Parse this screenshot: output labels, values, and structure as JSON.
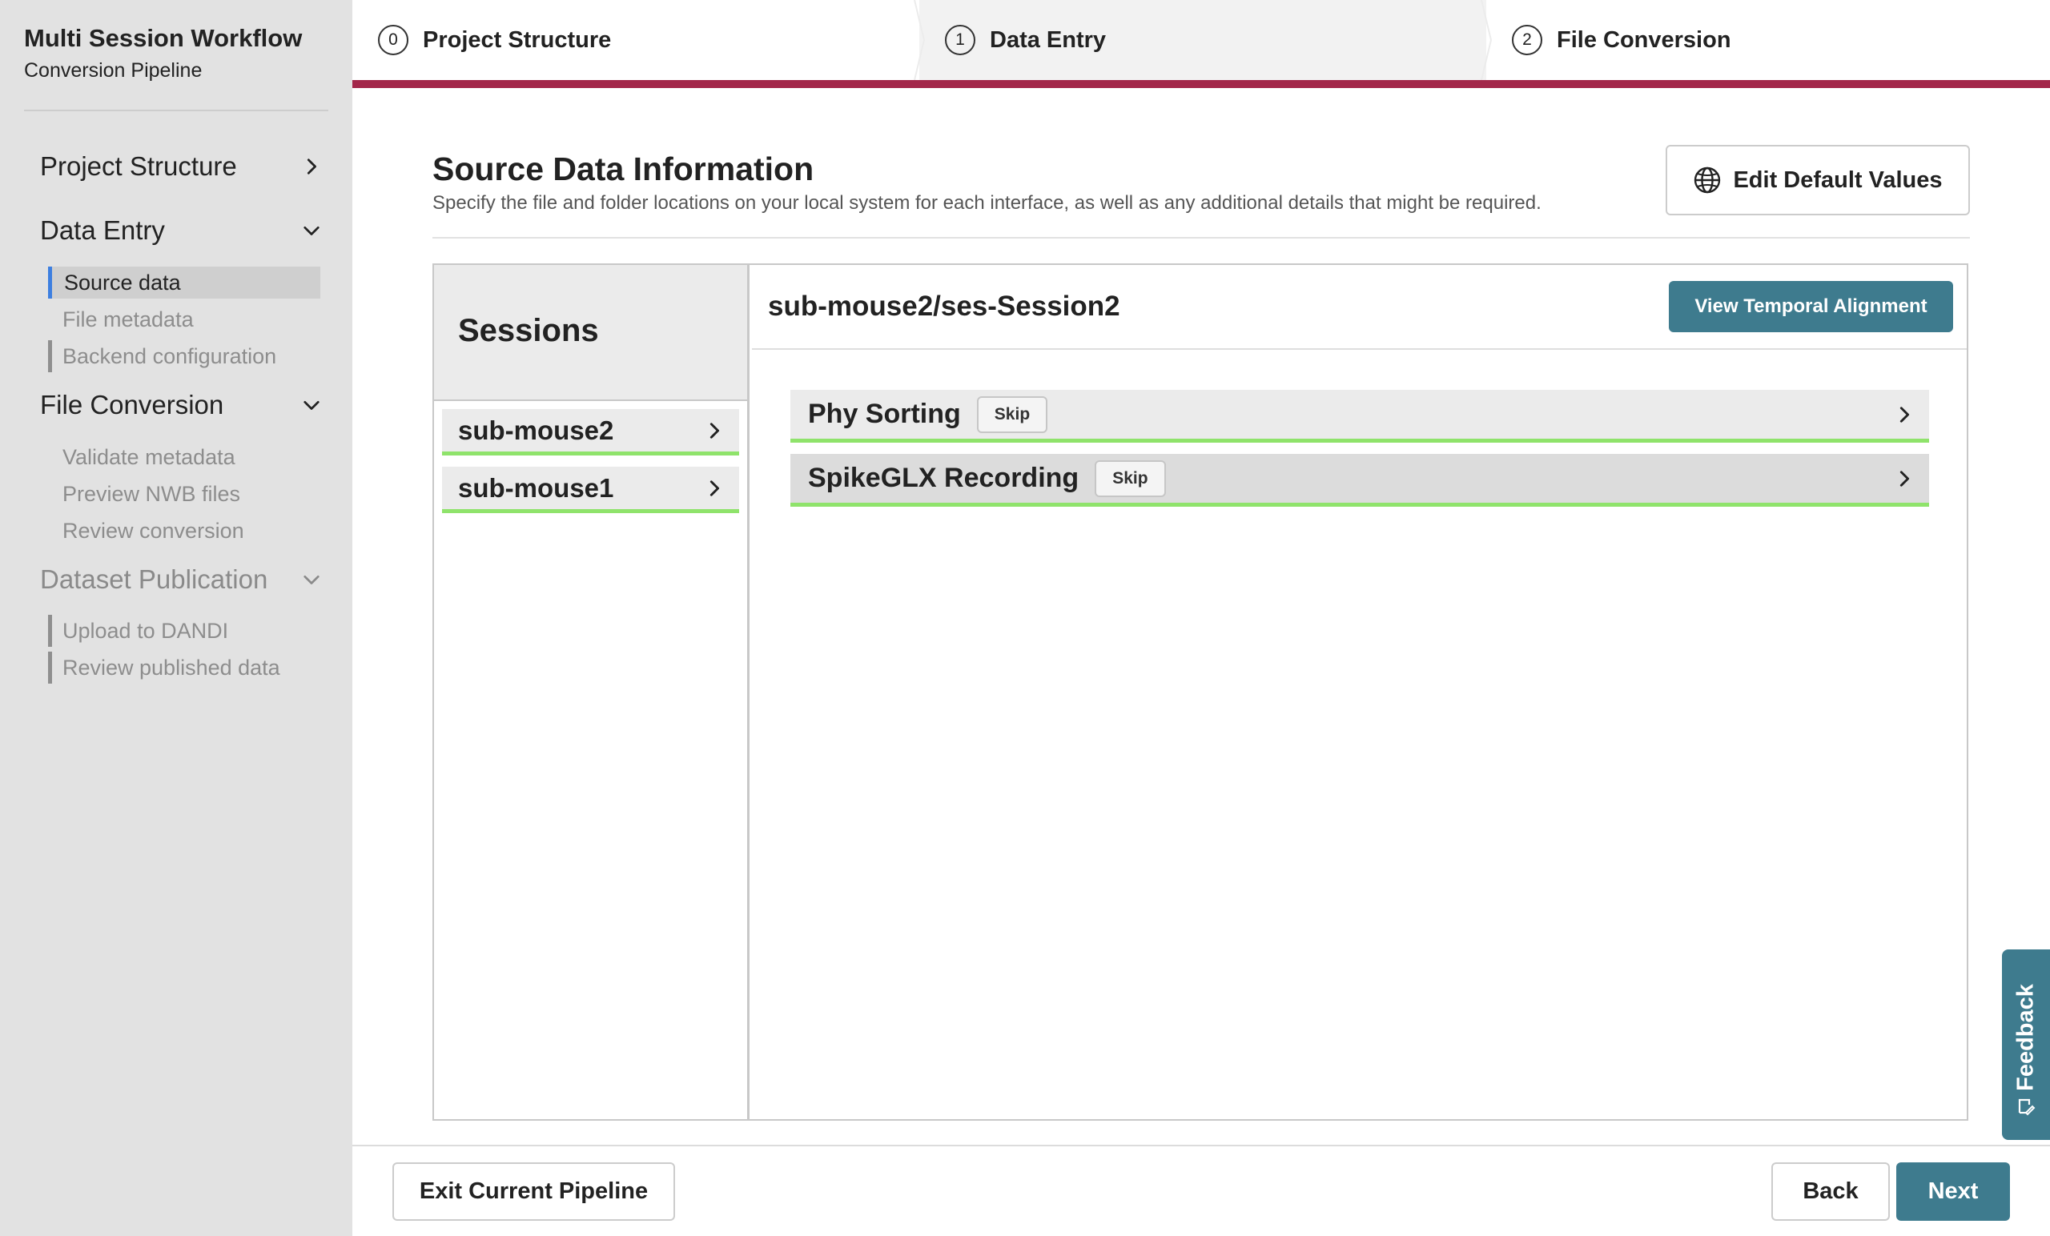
{
  "app": {
    "title": "Multi Session Workflow",
    "subtitle": "Conversion Pipeline"
  },
  "sidebar": {
    "sections": [
      {
        "label": "Project Structure",
        "icon": "chevron-right-icon"
      },
      {
        "label": "Data Entry",
        "icon": "chevron-down-icon"
      },
      {
        "label": "File Conversion",
        "icon": "chevron-down-icon"
      },
      {
        "label": "Dataset Publication",
        "icon": "chevron-down-icon"
      }
    ],
    "data_entry_items": [
      "Source data",
      "File metadata",
      "Backend configuration"
    ],
    "file_conversion_items": [
      "Validate metadata",
      "Preview NWB files",
      "Review conversion"
    ],
    "publication_items": [
      "Upload to DANDI",
      "Review published data"
    ],
    "active_item": "Source data",
    "active_color": "#3d7fe0"
  },
  "stepper": {
    "steps": [
      {
        "num": "0",
        "label": "Project Structure"
      },
      {
        "num": "1",
        "label": "Data Entry"
      },
      {
        "num": "2",
        "label": "File Conversion"
      }
    ],
    "active_step": "1",
    "bar_color": "#a3274a"
  },
  "header": {
    "title": "Source Data Information",
    "description": "Specify the file and folder locations on your local system for each interface, as well as any additional details that might be required.",
    "edit_defaults_label": "Edit Default Values",
    "edit_defaults_icon": "globe-icon"
  },
  "sessions": {
    "title": "Sessions",
    "items": [
      "sub-mouse2",
      "sub-mouse1"
    ],
    "status_color": "#8fe36b"
  },
  "detail": {
    "title": "sub-mouse2/ses-Session2",
    "temporal_button": "View Temporal Alignment",
    "interfaces": [
      {
        "label": "Phy Sorting",
        "skip": "Skip"
      },
      {
        "label": "SpikeGLX Recording",
        "skip": "Skip"
      }
    ]
  },
  "footer": {
    "exit_label": "Exit Current Pipeline",
    "back_label": "Back",
    "next_label": "Next"
  },
  "feedback": {
    "label": "Feedback",
    "icon": "edit-icon"
  },
  "colors": {
    "primary": "#3e7b8e",
    "sidebar_bg": "#e2e2e2"
  }
}
